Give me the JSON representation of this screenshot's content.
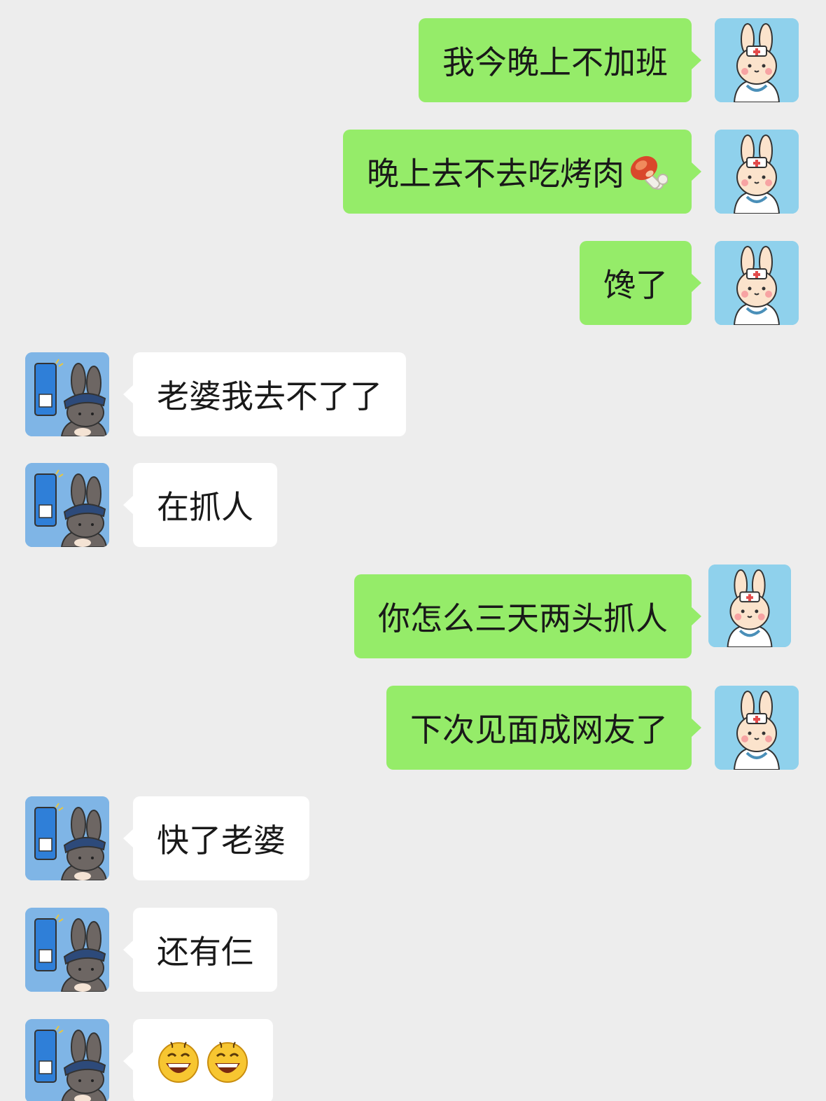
{
  "colors": {
    "background": "#ededed",
    "sent_bubble": "#95ec69",
    "received_bubble": "#ffffff",
    "sent_avatar_bg": "#8fd1ec",
    "received_avatar_bg": "#7fb5e6"
  },
  "avatars": {
    "self": "nurse-bunny-avatar",
    "contact": "police-bunny-avatar"
  },
  "messages": [
    {
      "sender": "self",
      "text": "我今晚上不加班"
    },
    {
      "sender": "self",
      "text": "晚上去不去吃烤肉",
      "emoji": "meat-on-bone-emoji"
    },
    {
      "sender": "self",
      "text": "馋了"
    },
    {
      "sender": "contact",
      "text": "老婆我去不了了"
    },
    {
      "sender": "contact",
      "text": "在抓人"
    },
    {
      "sender": "self",
      "text": "你怎么三天两头抓人"
    },
    {
      "sender": "self",
      "text": "下次见面成网友了"
    },
    {
      "sender": "contact",
      "text": "快了老婆"
    },
    {
      "sender": "contact",
      "text": "还有仨"
    },
    {
      "sender": "contact",
      "text": "",
      "emojis": [
        "grinning-face-emoji",
        "grinning-face-emoji"
      ]
    }
  ]
}
